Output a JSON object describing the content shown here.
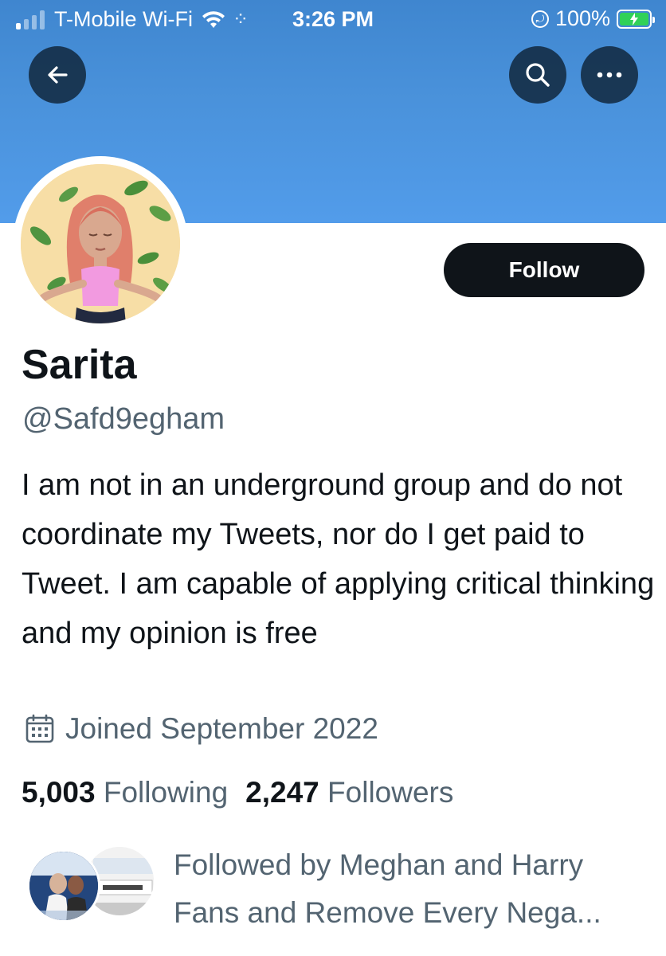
{
  "status_bar": {
    "carrier": "T-Mobile Wi-Fi",
    "time": "3:26 PM",
    "battery": "100%",
    "battery_level": 1.0,
    "signal_bars_on": 1,
    "signal_bars_total": 4
  },
  "nav": {
    "back_icon": "arrow-left-icon",
    "search_icon": "search-icon",
    "more_icon": "more-horizontal-icon"
  },
  "profile": {
    "display_name": "Sarita",
    "handle": "@Safd9egham",
    "bio": "I am not in an underground group and do not coordinate my Tweets, nor do I get paid to Tweet. I am capable of applying critical thinking and my opinion is free",
    "joined": "Joined September 2022",
    "following_count": "5,003",
    "following_label": "Following",
    "followers_count": "2,247",
    "followers_label": "Followers",
    "follow_button": "Follow",
    "followed_by": "Followed by Meghan and Harry Fans and Remove Every Nega..."
  },
  "colors": {
    "banner": "#4a92db",
    "follow_button_bg": "#0f1419",
    "secondary_text": "#536471",
    "battery": "#30d158"
  }
}
